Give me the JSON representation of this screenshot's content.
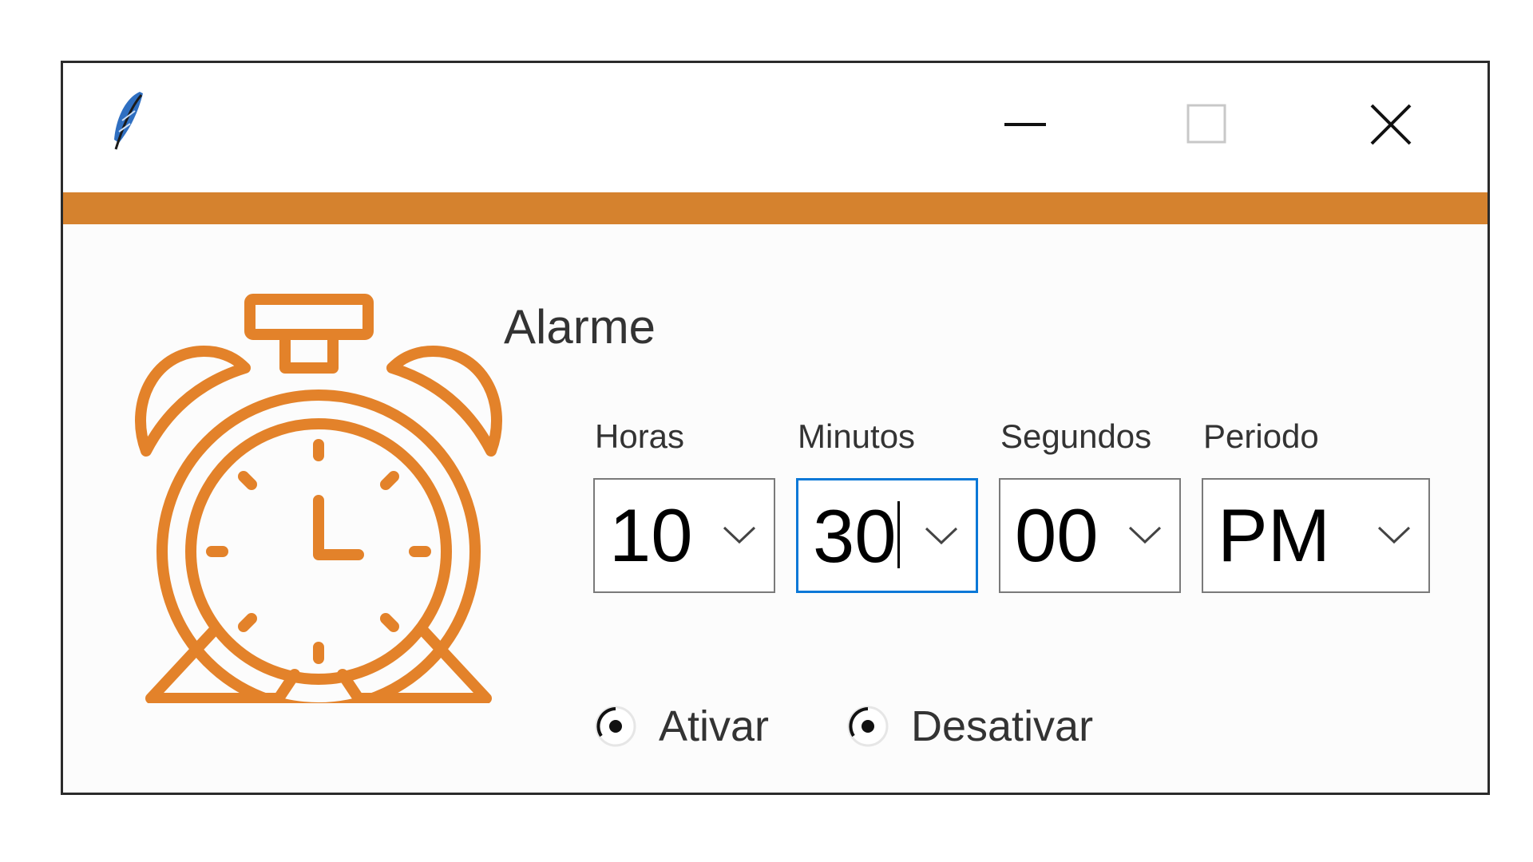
{
  "window": {
    "accent_color": "#d5822e",
    "icon": "feather-icon",
    "controls": [
      "minimize-icon",
      "maximize-icon",
      "close-icon"
    ]
  },
  "alarm": {
    "title": "Alarme",
    "illustration": "alarm-clock-icon",
    "fields": {
      "hours": {
        "label": "Horas",
        "value": "10"
      },
      "minutes": {
        "label": "Minutos",
        "value": "30"
      },
      "seconds": {
        "label": "Segundos",
        "value": "00"
      },
      "period": {
        "label": "Periodo",
        "value": "PM"
      }
    },
    "radios": {
      "activate": "Ativar",
      "deactivate": "Desativar"
    }
  }
}
